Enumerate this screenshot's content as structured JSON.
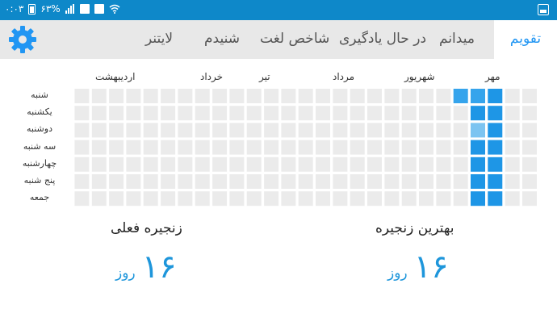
{
  "status_bar": {
    "time": "۰:۰۳",
    "battery": "۶۳%",
    "icons": [
      "battery-icon",
      "cell-signal-icon",
      "image-notification-icon",
      "calendar-notification-icon",
      "wifi-icon"
    ],
    "right_icon": "gallery-icon"
  },
  "tabs": [
    {
      "id": "calendar",
      "label": "تقویم",
      "active": true
    },
    {
      "id": "field",
      "label": "میدانم",
      "active": false
    },
    {
      "id": "learning",
      "label": "در حال یادگیری",
      "active": false
    },
    {
      "id": "index",
      "label": "شاخص لغت",
      "active": false
    },
    {
      "id": "heard",
      "label": "شنیدم",
      "active": false
    },
    {
      "id": "lightner",
      "label": "لایتنر",
      "active": false
    }
  ],
  "settings_icon": "gear-icon",
  "calendar": {
    "months": [
      "مهر",
      "شهریور",
      "مرداد",
      "تیر",
      "خرداد",
      "اردیبهشت"
    ],
    "days": [
      "شنبه",
      "یکشنبه",
      "دوشنبه",
      "سه شنبه",
      "چهارشنبه",
      "پنج شنبه",
      "جمعه"
    ],
    "weeks": 27,
    "active_cells": [
      {
        "week": 3,
        "day": 0,
        "level": "medium"
      },
      {
        "week": 4,
        "day": 0,
        "level": "medium"
      },
      {
        "week": 2,
        "day": 0,
        "level": "full"
      },
      {
        "week": 2,
        "day": 1,
        "level": "full"
      },
      {
        "week": 3,
        "day": 1,
        "level": "full"
      },
      {
        "week": 2,
        "day": 2,
        "level": "full"
      },
      {
        "week": 3,
        "day": 2,
        "level": "full"
      },
      {
        "week": 2,
        "day": 3,
        "level": "full"
      },
      {
        "week": 3,
        "day": 3,
        "level": "full"
      },
      {
        "week": 2,
        "day": 4,
        "level": "full"
      },
      {
        "week": 3,
        "day": 4,
        "level": "full"
      },
      {
        "week": 2,
        "day": 5,
        "level": "full"
      },
      {
        "week": 3,
        "day": 5,
        "level": "full"
      },
      {
        "week": 2,
        "day": 6,
        "level": "full"
      },
      {
        "week": 3,
        "day": 6,
        "level": "full"
      },
      {
        "week": 3,
        "day": 2,
        "level": "light"
      }
    ],
    "colors": {
      "empty": "#ebebeb",
      "full": "#1e96e6",
      "medium": "#35a4ec",
      "light": "#7cc4f1"
    }
  },
  "best_streak": {
    "title": "بهترین زنجیره",
    "value": "۱۶",
    "unit": "روز"
  },
  "current_streak": {
    "title": "زنجیره فعلی",
    "value": "۱۶",
    "unit": "روز"
  }
}
